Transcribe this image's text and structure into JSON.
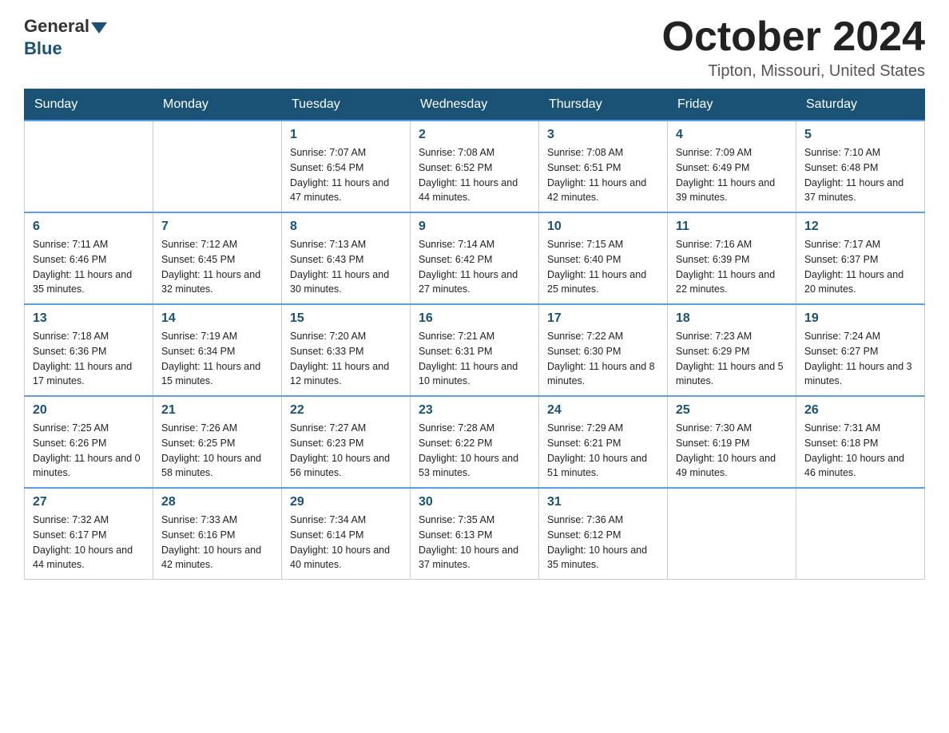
{
  "header": {
    "logo_general": "General",
    "logo_blue": "Blue",
    "month_title": "October 2024",
    "location": "Tipton, Missouri, United States"
  },
  "days_of_week": [
    "Sunday",
    "Monday",
    "Tuesday",
    "Wednesday",
    "Thursday",
    "Friday",
    "Saturday"
  ],
  "weeks": [
    [
      {
        "day": "",
        "info": ""
      },
      {
        "day": "",
        "info": ""
      },
      {
        "day": "1",
        "info": "Sunrise: 7:07 AM\nSunset: 6:54 PM\nDaylight: 11 hours\nand 47 minutes."
      },
      {
        "day": "2",
        "info": "Sunrise: 7:08 AM\nSunset: 6:52 PM\nDaylight: 11 hours\nand 44 minutes."
      },
      {
        "day": "3",
        "info": "Sunrise: 7:08 AM\nSunset: 6:51 PM\nDaylight: 11 hours\nand 42 minutes."
      },
      {
        "day": "4",
        "info": "Sunrise: 7:09 AM\nSunset: 6:49 PM\nDaylight: 11 hours\nand 39 minutes."
      },
      {
        "day": "5",
        "info": "Sunrise: 7:10 AM\nSunset: 6:48 PM\nDaylight: 11 hours\nand 37 minutes."
      }
    ],
    [
      {
        "day": "6",
        "info": "Sunrise: 7:11 AM\nSunset: 6:46 PM\nDaylight: 11 hours\nand 35 minutes."
      },
      {
        "day": "7",
        "info": "Sunrise: 7:12 AM\nSunset: 6:45 PM\nDaylight: 11 hours\nand 32 minutes."
      },
      {
        "day": "8",
        "info": "Sunrise: 7:13 AM\nSunset: 6:43 PM\nDaylight: 11 hours\nand 30 minutes."
      },
      {
        "day": "9",
        "info": "Sunrise: 7:14 AM\nSunset: 6:42 PM\nDaylight: 11 hours\nand 27 minutes."
      },
      {
        "day": "10",
        "info": "Sunrise: 7:15 AM\nSunset: 6:40 PM\nDaylight: 11 hours\nand 25 minutes."
      },
      {
        "day": "11",
        "info": "Sunrise: 7:16 AM\nSunset: 6:39 PM\nDaylight: 11 hours\nand 22 minutes."
      },
      {
        "day": "12",
        "info": "Sunrise: 7:17 AM\nSunset: 6:37 PM\nDaylight: 11 hours\nand 20 minutes."
      }
    ],
    [
      {
        "day": "13",
        "info": "Sunrise: 7:18 AM\nSunset: 6:36 PM\nDaylight: 11 hours\nand 17 minutes."
      },
      {
        "day": "14",
        "info": "Sunrise: 7:19 AM\nSunset: 6:34 PM\nDaylight: 11 hours\nand 15 minutes."
      },
      {
        "day": "15",
        "info": "Sunrise: 7:20 AM\nSunset: 6:33 PM\nDaylight: 11 hours\nand 12 minutes."
      },
      {
        "day": "16",
        "info": "Sunrise: 7:21 AM\nSunset: 6:31 PM\nDaylight: 11 hours\nand 10 minutes."
      },
      {
        "day": "17",
        "info": "Sunrise: 7:22 AM\nSunset: 6:30 PM\nDaylight: 11 hours\nand 8 minutes."
      },
      {
        "day": "18",
        "info": "Sunrise: 7:23 AM\nSunset: 6:29 PM\nDaylight: 11 hours\nand 5 minutes."
      },
      {
        "day": "19",
        "info": "Sunrise: 7:24 AM\nSunset: 6:27 PM\nDaylight: 11 hours\nand 3 minutes."
      }
    ],
    [
      {
        "day": "20",
        "info": "Sunrise: 7:25 AM\nSunset: 6:26 PM\nDaylight: 11 hours\nand 0 minutes."
      },
      {
        "day": "21",
        "info": "Sunrise: 7:26 AM\nSunset: 6:25 PM\nDaylight: 10 hours\nand 58 minutes."
      },
      {
        "day": "22",
        "info": "Sunrise: 7:27 AM\nSunset: 6:23 PM\nDaylight: 10 hours\nand 56 minutes."
      },
      {
        "day": "23",
        "info": "Sunrise: 7:28 AM\nSunset: 6:22 PM\nDaylight: 10 hours\nand 53 minutes."
      },
      {
        "day": "24",
        "info": "Sunrise: 7:29 AM\nSunset: 6:21 PM\nDaylight: 10 hours\nand 51 minutes."
      },
      {
        "day": "25",
        "info": "Sunrise: 7:30 AM\nSunset: 6:19 PM\nDaylight: 10 hours\nand 49 minutes."
      },
      {
        "day": "26",
        "info": "Sunrise: 7:31 AM\nSunset: 6:18 PM\nDaylight: 10 hours\nand 46 minutes."
      }
    ],
    [
      {
        "day": "27",
        "info": "Sunrise: 7:32 AM\nSunset: 6:17 PM\nDaylight: 10 hours\nand 44 minutes."
      },
      {
        "day": "28",
        "info": "Sunrise: 7:33 AM\nSunset: 6:16 PM\nDaylight: 10 hours\nand 42 minutes."
      },
      {
        "day": "29",
        "info": "Sunrise: 7:34 AM\nSunset: 6:14 PM\nDaylight: 10 hours\nand 40 minutes."
      },
      {
        "day": "30",
        "info": "Sunrise: 7:35 AM\nSunset: 6:13 PM\nDaylight: 10 hours\nand 37 minutes."
      },
      {
        "day": "31",
        "info": "Sunrise: 7:36 AM\nSunset: 6:12 PM\nDaylight: 10 hours\nand 35 minutes."
      },
      {
        "day": "",
        "info": ""
      },
      {
        "day": "",
        "info": ""
      }
    ]
  ]
}
